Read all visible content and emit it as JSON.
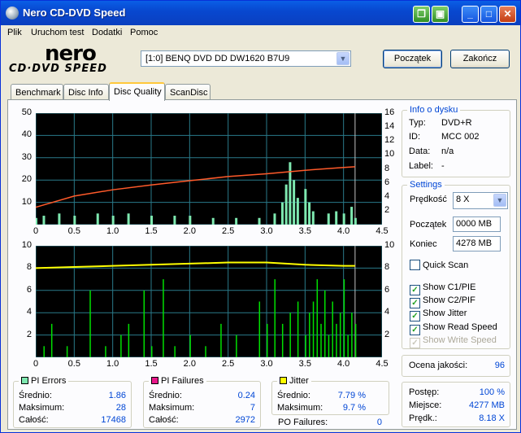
{
  "window": {
    "title": "Nero CD-DVD Speed"
  },
  "menu": [
    "Plik",
    "Uruchom test",
    "Dodatki",
    "Pomoc"
  ],
  "logo": {
    "line1": "nero",
    "line2": "CD·DVD SPEED"
  },
  "drive": {
    "selected": "[1:0]   BENQ DVD DD DW1620 B7U9"
  },
  "buttons": {
    "start": "Początek",
    "finish": "Zakończ"
  },
  "tabs": [
    "Benchmark",
    "Disc Info",
    "Disc Quality",
    "ScanDisc"
  ],
  "disc_info": {
    "title": "Info o dysku",
    "rows": [
      {
        "label": "Typ:",
        "value": "DVD+R"
      },
      {
        "label": "ID:",
        "value": "MCC 002"
      },
      {
        "label": "Data:",
        "value": "n/a"
      },
      {
        "label": "Label:",
        "value": "-"
      }
    ]
  },
  "settings": {
    "title": "Settings",
    "speed_label": "Prędkość",
    "speed_value": "8 X",
    "start_label": "Początek",
    "start_value": "0000 MB",
    "end_label": "Koniec",
    "end_value": "4278 MB",
    "quick_scan": "Quick Scan",
    "show_c1": "Show C1/PIE",
    "show_c2": "Show C2/PIF",
    "show_jitter": "Show Jitter",
    "show_read": "Show Read Speed",
    "show_write": "Show Write Speed"
  },
  "quality": {
    "label": "Ocena jakości:",
    "value": "96"
  },
  "progress": {
    "rows": [
      {
        "label": "Postęp:",
        "value": "100 %"
      },
      {
        "label": "Miejsce:",
        "value": "4277 MB"
      },
      {
        "label": "Prędk.:",
        "value": "8.18 X"
      }
    ]
  },
  "pi_errors": {
    "title": "PI Errors",
    "color": "#7ee8b0",
    "rows": [
      {
        "label": "Średnio:",
        "value": "1.86"
      },
      {
        "label": "Maksimum:",
        "value": "28"
      },
      {
        "label": "Całość:",
        "value": "17468"
      }
    ]
  },
  "pi_failures": {
    "title": "PI Failures",
    "color": "#e8188a",
    "rows": [
      {
        "label": "Średnio:",
        "value": "0.24"
      },
      {
        "label": "Maksimum:",
        "value": "7"
      },
      {
        "label": "Całość:",
        "value": "2972"
      }
    ]
  },
  "jitter": {
    "title": "Jitter",
    "color": "#ffff00",
    "rows": [
      {
        "label": "Średnio:",
        "value": "7.79 %"
      },
      {
        "label": "Maksimum:",
        "value": "9.7 %"
      }
    ]
  },
  "po_failures": {
    "label": "PO Failures:",
    "value": "0"
  },
  "chart_data": [
    {
      "type": "area",
      "ylim": [
        0,
        50
      ],
      "y2lim": [
        0,
        16
      ],
      "xlim": [
        0,
        4.5
      ],
      "yticks": [
        "50",
        "40",
        "30",
        "20",
        "10"
      ],
      "y2ticks": [
        "16",
        "14",
        "12",
        "10",
        "8",
        "6",
        "4",
        "2"
      ],
      "xticks": [
        "0",
        "0.5",
        "1.0",
        "1.5",
        "2.0",
        "2.5",
        "3.0",
        "3.5",
        "4.0",
        "4.5"
      ],
      "grid": true,
      "series": [
        {
          "color": "#7ee8b0",
          "points": [
            [
              0,
              3
            ],
            [
              0.1,
              4
            ],
            [
              0.3,
              5
            ],
            [
              0.5,
              4
            ],
            [
              0.8,
              5
            ],
            [
              1.0,
              4
            ],
            [
              1.2,
              5
            ],
            [
              1.5,
              4
            ],
            [
              1.8,
              4
            ],
            [
              2.0,
              4
            ],
            [
              2.3,
              3
            ],
            [
              2.6,
              3
            ],
            [
              2.9,
              3
            ],
            [
              3.1,
              5
            ],
            [
              3.2,
              10
            ],
            [
              3.25,
              18
            ],
            [
              3.3,
              28
            ],
            [
              3.35,
              20
            ],
            [
              3.4,
              12
            ],
            [
              3.5,
              16
            ],
            [
              3.55,
              10
            ],
            [
              3.6,
              6
            ],
            [
              3.8,
              5
            ],
            [
              3.9,
              6
            ],
            [
              4.0,
              5
            ],
            [
              4.1,
              8
            ],
            [
              4.15,
              3
            ]
          ]
        },
        {
          "color": "#ff5a2a",
          "points": [
            [
              0,
              2.5
            ],
            [
              0.5,
              4.1
            ],
            [
              1.0,
              5.0
            ],
            [
              1.5,
              5.7
            ],
            [
              2.0,
              6.3
            ],
            [
              2.5,
              6.9
            ],
            [
              3.0,
              7.3
            ],
            [
              3.5,
              7.8
            ],
            [
              4.0,
              8.2
            ],
            [
              4.15,
              8.3
            ]
          ]
        }
      ]
    },
    {
      "type": "bar",
      "ylim": [
        0,
        10
      ],
      "y2lim": [
        0,
        10
      ],
      "xlim": [
        0,
        4.5
      ],
      "yticks": [
        "10",
        "8",
        "6",
        "4",
        "2"
      ],
      "y2ticks": [
        "10",
        "8",
        "6",
        "4",
        "2"
      ],
      "xticks": [
        "0",
        "0.5",
        "1.0",
        "1.5",
        "2.0",
        "2.5",
        "3.0",
        "3.5",
        "4.0",
        "4.5"
      ],
      "grid": true,
      "series": [
        {
          "color": "#00e000",
          "points": [
            [
              0.1,
              1
            ],
            [
              0.2,
              3
            ],
            [
              0.4,
              1
            ],
            [
              0.7,
              6
            ],
            [
              0.9,
              1
            ],
            [
              1.1,
              2
            ],
            [
              1.2,
              3
            ],
            [
              1.4,
              6
            ],
            [
              1.5,
              1
            ],
            [
              1.65,
              7
            ],
            [
              1.8,
              1
            ],
            [
              2.0,
              2
            ],
            [
              2.2,
              1
            ],
            [
              2.4,
              3
            ],
            [
              2.6,
              2
            ],
            [
              2.9,
              5
            ],
            [
              3.0,
              3
            ],
            [
              3.1,
              7
            ],
            [
              3.2,
              3
            ],
            [
              3.3,
              4
            ],
            [
              3.4,
              5
            ],
            [
              3.5,
              2
            ],
            [
              3.55,
              4
            ],
            [
              3.6,
              5
            ],
            [
              3.65,
              7
            ],
            [
              3.7,
              3
            ],
            [
              3.75,
              6
            ],
            [
              3.8,
              2
            ],
            [
              3.85,
              5
            ],
            [
              3.9,
              3
            ],
            [
              3.95,
              4
            ],
            [
              4.0,
              7
            ],
            [
              4.05,
              2
            ],
            [
              4.1,
              4
            ],
            [
              4.15,
              3
            ]
          ]
        },
        {
          "color": "#ffff00",
          "points": [
            [
              0,
              8.0
            ],
            [
              0.5,
              8.1
            ],
            [
              1.0,
              8.2
            ],
            [
              1.5,
              8.3
            ],
            [
              2.0,
              8.4
            ],
            [
              2.5,
              8.5
            ],
            [
              3.0,
              8.5
            ],
            [
              3.5,
              8.3
            ],
            [
              4.0,
              8.2
            ],
            [
              4.15,
              8.2
            ]
          ]
        }
      ]
    }
  ]
}
